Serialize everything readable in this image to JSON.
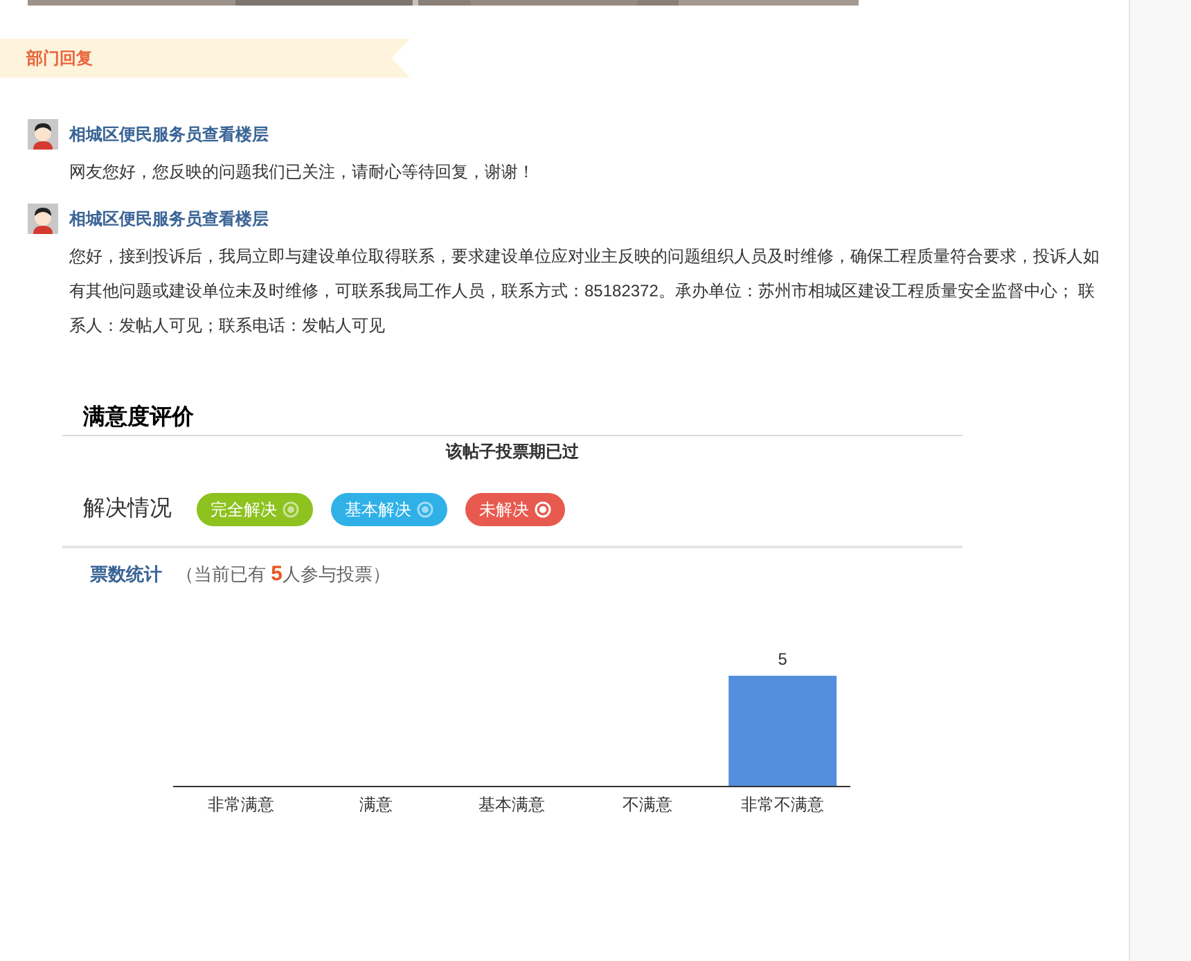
{
  "section_header": "部门回复",
  "replies": [
    {
      "author": "相城区便民服务员查看楼层",
      "text": "网友您好，您反映的问题我们已关注，请耐心等待回复，谢谢！"
    },
    {
      "author": "相城区便民服务员查看楼层",
      "text": "您好，接到投诉后，我局立即与建设单位取得联系，要求建设单位应对业主反映的问题组织人员及时维修，确保工程质量符合要求，投诉人如有其他问题或建设单位未及时维修，可联系我局工作人员，联系方式：85182372。承办单位：苏州市相城区建设工程质量安全监督中心； 联系人：发帖人可见；联系电话：发帖人可见"
    }
  ],
  "rating": {
    "title": "满意度评价",
    "notice": "该帖子投票期已过",
    "resolution_label": "解决情况",
    "options": [
      {
        "label": "完全解决",
        "color": "#8dc21f",
        "selected": false
      },
      {
        "label": "基本解决",
        "color": "#2fb1e8",
        "selected": false
      },
      {
        "label": "未解决",
        "color": "#e85a4f",
        "selected": true
      }
    ]
  },
  "stats": {
    "title": "票数统计",
    "summary": "（当前已有 **5**人参与投票）",
    "chart_data": {
      "type": "bar",
      "categories": [
        "非常满意",
        "满意",
        "基本满意",
        "不满意",
        "非常不满意"
      ],
      "series": [
        {
          "color": "#548fde",
          "values": [
            null,
            null,
            null,
            null,
            5
          ]
        }
      ],
      "data_labels": true
    }
  }
}
